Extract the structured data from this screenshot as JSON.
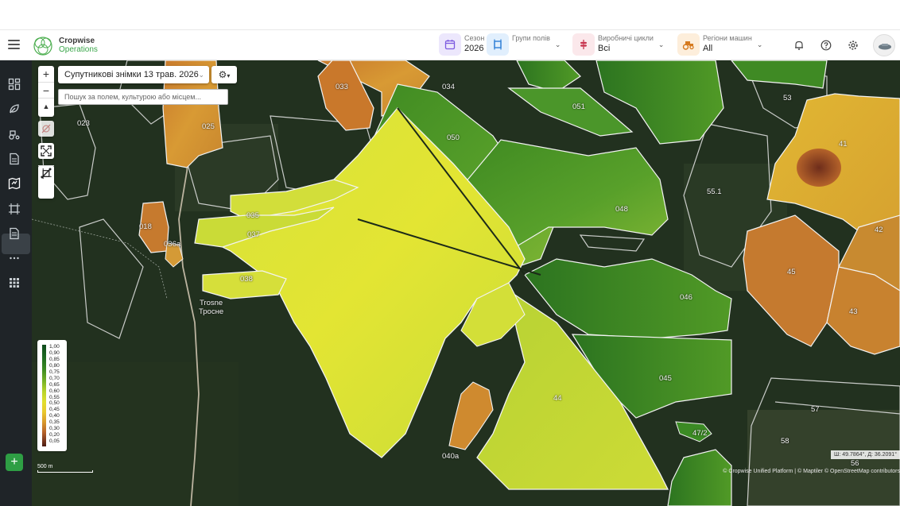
{
  "app": {
    "brand_line1": "Cropwise",
    "brand_line2": "Operations"
  },
  "header": {
    "season": {
      "label": "Сезон",
      "value": "2026"
    },
    "field_groups": {
      "label": "Групи полів"
    },
    "production_cycles": {
      "label": "Виробничі цикли",
      "value": "Всі"
    },
    "machine_regions": {
      "label": "Регіони машин",
      "value": "All"
    },
    "colors": {
      "season": "#e9e4fb",
      "groups": "#e0effd",
      "cycles": "#fbe7ea",
      "regions": "#fdeedb"
    }
  },
  "map": {
    "image_selector": "Супутникові знімки 13 трав. 2026",
    "search": {
      "placeholder": "Пошук за полем, культурою або місцем..."
    },
    "zoom_in": "+",
    "zoom_out": "−",
    "north": "▲",
    "legend_ticks": [
      "1,00",
      "0,90",
      "0,85",
      "0,80",
      "0,75",
      "0,70",
      "0,65",
      "0,60",
      "0,55",
      "0,50",
      "0,45",
      "0,40",
      "0,35",
      "0,30",
      "0,20",
      "0,05"
    ],
    "scale": "500 m",
    "coords": "Ш: 49.7864°, Д: 36.2091°",
    "attribution": "© Cropwise Unified Platform | © Maptiler © OpenStreetMap contributors",
    "place_name_1": "Trosne",
    "place_name_2": "Тросне",
    "field_labels": {
      "f023": "023",
      "f025": "025",
      "f033": "033",
      "f034": "034",
      "f051": "051",
      "f053": "53",
      "f050": "050",
      "f048": "048",
      "f551": "55.1",
      "f41": "41",
      "f42": "42",
      "f45": "45",
      "f43": "43",
      "f018": "018",
      "f036a": "036а",
      "f035": "035",
      "f037": "037",
      "f038": "038",
      "f046": "046",
      "f045": "045",
      "f44": "44",
      "f472": "47/2",
      "f040a": "040а",
      "f57": "57",
      "f58": "58",
      "f56": "56"
    }
  }
}
